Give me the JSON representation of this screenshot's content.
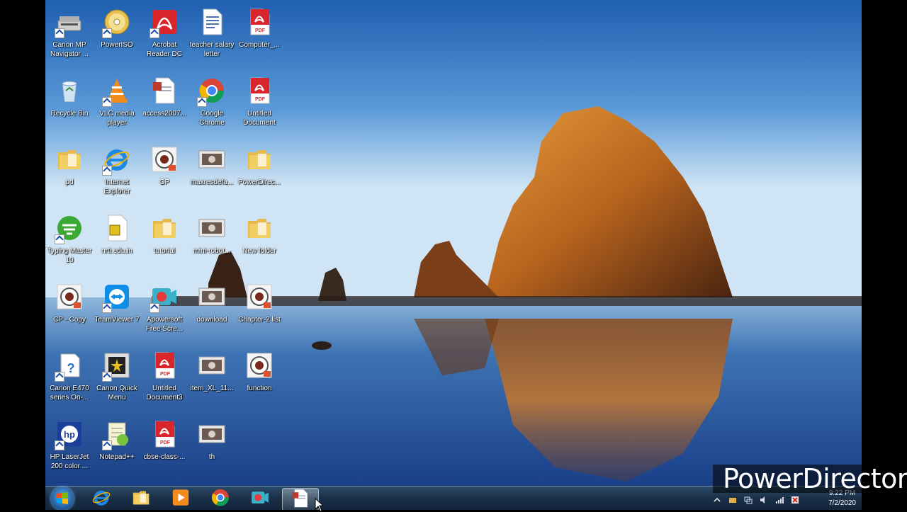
{
  "desktop": {
    "icons": [
      {
        "label": "Canon MP Navigator ...",
        "icon": "scanner-icon",
        "col": 0,
        "row": 0,
        "shortcut": true
      },
      {
        "label": "PowerISO",
        "icon": "disc-icon",
        "col": 1,
        "row": 0,
        "shortcut": true
      },
      {
        "label": "Acrobat Reader DC",
        "icon": "acrobat-icon",
        "col": 2,
        "row": 0,
        "shortcut": true
      },
      {
        "label": "teacher salary letter",
        "icon": "word-doc-icon",
        "col": 3,
        "row": 0,
        "shortcut": false
      },
      {
        "label": "Computer_...",
        "icon": "pdf-icon",
        "col": 4,
        "row": 0,
        "shortcut": false
      },
      {
        "label": "Recycle Bin",
        "icon": "recycle-bin-icon",
        "col": 0,
        "row": 1,
        "shortcut": false
      },
      {
        "label": "VLC media player",
        "icon": "vlc-icon",
        "col": 1,
        "row": 1,
        "shortcut": true
      },
      {
        "label": "access2007...",
        "icon": "document-icon",
        "col": 2,
        "row": 1,
        "shortcut": false
      },
      {
        "label": "Google Chrome",
        "icon": "chrome-icon",
        "col": 3,
        "row": 1,
        "shortcut": true
      },
      {
        "label": "Untitled Document",
        "icon": "pdf-icon",
        "col": 4,
        "row": 1,
        "shortcut": false
      },
      {
        "label": "pd",
        "icon": "folder-icon",
        "col": 0,
        "row": 2,
        "shortcut": false
      },
      {
        "label": "Internet Explorer",
        "icon": "ie-icon",
        "col": 1,
        "row": 2,
        "shortcut": true
      },
      {
        "label": "GP",
        "icon": "webcam-app-icon",
        "col": 2,
        "row": 2,
        "shortcut": false
      },
      {
        "label": "maxresdefa...",
        "icon": "image-thumbnail-icon",
        "col": 3,
        "row": 2,
        "shortcut": false
      },
      {
        "label": "PowerDirec...",
        "icon": "folder-icon",
        "col": 4,
        "row": 2,
        "shortcut": false
      },
      {
        "label": "Typing Master 10",
        "icon": "typing-master-icon",
        "col": 0,
        "row": 3,
        "shortcut": true
      },
      {
        "label": "nrti.edu.in",
        "icon": "file-icon",
        "col": 1,
        "row": 3,
        "shortcut": false
      },
      {
        "label": "tutorial",
        "icon": "folder-icon",
        "col": 2,
        "row": 3,
        "shortcut": false
      },
      {
        "label": "mini-robot...",
        "icon": "image-thumbnail-icon",
        "col": 3,
        "row": 3,
        "shortcut": false
      },
      {
        "label": "New folder",
        "icon": "folder-icon",
        "col": 4,
        "row": 3,
        "shortcut": false
      },
      {
        "label": "CP - Copy",
        "icon": "webcam-app-icon",
        "col": 0,
        "row": 4,
        "shortcut": false
      },
      {
        "label": "TeamViewer 7",
        "icon": "teamviewer-icon",
        "col": 1,
        "row": 4,
        "shortcut": true
      },
      {
        "label": "Apowersoft Free Scre...",
        "icon": "screen-recorder-icon",
        "col": 2,
        "row": 4,
        "shortcut": true
      },
      {
        "label": "download",
        "icon": "image-thumbnail-icon",
        "col": 3,
        "row": 4,
        "shortcut": false
      },
      {
        "label": "Chapter-2 list",
        "icon": "webcam-app-icon",
        "col": 4,
        "row": 4,
        "shortcut": false
      },
      {
        "label": "Canon E470 series On-...",
        "icon": "help-doc-icon",
        "col": 0,
        "row": 5,
        "shortcut": true
      },
      {
        "label": "Canon Quick Menu",
        "icon": "canon-menu-icon",
        "col": 1,
        "row": 5,
        "shortcut": true
      },
      {
        "label": "Untitled Document3",
        "icon": "pdf-icon",
        "col": 2,
        "row": 5,
        "shortcut": false
      },
      {
        "label": "item_XL_11...",
        "icon": "image-thumbnail-icon",
        "col": 3,
        "row": 5,
        "shortcut": false
      },
      {
        "label": "function",
        "icon": "webcam-app-icon",
        "col": 4,
        "row": 5,
        "shortcut": false
      },
      {
        "label": "HP LaserJet 200 color ...",
        "icon": "hp-icon",
        "col": 0,
        "row": 6,
        "shortcut": true
      },
      {
        "label": "Notepad++",
        "icon": "notepad-plus-icon",
        "col": 1,
        "row": 6,
        "shortcut": true
      },
      {
        "label": "cbse-class-...",
        "icon": "pdf-icon",
        "col": 2,
        "row": 6,
        "shortcut": false
      },
      {
        "label": "th",
        "icon": "image-thumbnail-icon",
        "col": 3,
        "row": 6,
        "shortcut": false
      }
    ]
  },
  "taskbar": {
    "items": [
      {
        "name": "taskbar-ie",
        "icon": "ie-icon"
      },
      {
        "name": "taskbar-explorer",
        "icon": "folder-icon"
      },
      {
        "name": "taskbar-media-player",
        "icon": "media-player-icon"
      },
      {
        "name": "taskbar-chrome",
        "icon": "chrome-icon"
      },
      {
        "name": "taskbar-screen-recorder",
        "icon": "screen-recorder-icon"
      },
      {
        "name": "taskbar-active-window",
        "icon": "document-icon",
        "active": true
      }
    ],
    "clock": {
      "time": "9:22 PM",
      "date": "7/2/2020"
    }
  },
  "watermark": {
    "text": "PowerDirector"
  },
  "colors": {
    "pdf_red": "#d8262c",
    "folder_yellow": "#f2cf63",
    "sky_top": "#1f5fb0",
    "taskbar": "#1b3149"
  }
}
